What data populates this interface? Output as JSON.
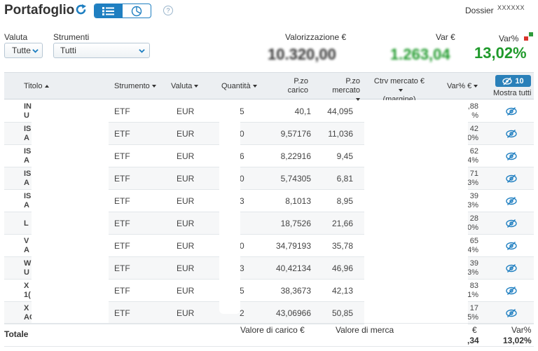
{
  "header": {
    "title": "Portafoglio",
    "dossier_label": "Dossier",
    "dossier_value": "XXXXXX",
    "help_label": "?"
  },
  "filters": {
    "valuta_label": "Valuta",
    "valuta_value": "Tutte",
    "strumenti_label": "Strumenti",
    "strumenti_value": "Tutti"
  },
  "summary": {
    "valorizzazione_label": "Valorizzazione €",
    "valorizzazione_value": "10.320,00",
    "var_eur_label": "Var €",
    "var_eur_value": "1.263,04",
    "var_pct_label": "Var%",
    "var_pct_value": "13,02%"
  },
  "table": {
    "columns": {
      "titolo": "Titolo",
      "strumento": "Strumento",
      "valuta": "Valuta",
      "quantita": "Quantità",
      "pzo_carico_1": "P.zo",
      "pzo_carico_2": "carico",
      "pzo_mercato_1": "P.zo",
      "pzo_mercato_2": "mercato",
      "ctrv_1": "Ctrv mercato €",
      "ctrv_2": "(margine)",
      "varpct": "Var% €"
    },
    "hidden_count": "10",
    "mostra_tutti": "Mostra tutti",
    "rows": [
      {
        "t1": "IN",
        "t2": "U",
        "strumento": "ETF",
        "valuta": "EUR",
        "qty": "5",
        "carico": "40,1",
        "mercato": "44,095",
        "v1": ",88",
        "v2": "%"
      },
      {
        "t1": "IS",
        "t2": "A",
        "strumento": "ETF",
        "valuta": "EUR",
        "qty": "0",
        "carico": "9,57176",
        "mercato": "11,036",
        "v1": "42",
        "v2": "0%"
      },
      {
        "t1": "IS",
        "t2": "A",
        "strumento": "ETF",
        "valuta": "EUR",
        "qty": "6",
        "carico": "8,22916",
        "mercato": "9,45",
        "v1": "62",
        "v2": "4%"
      },
      {
        "t1": "IS",
        "t2": "A",
        "strumento": "ETF",
        "valuta": "EUR",
        "qty": "0",
        "carico": "5,74305",
        "mercato": "6,81",
        "v1": "71",
        "v2": "3%"
      },
      {
        "t1": "IS",
        "t2": "A",
        "strumento": "ETF",
        "valuta": "EUR",
        "qty": "3",
        "carico": "8,1013",
        "mercato": "8,95",
        "v1": "39",
        "v2": "3%"
      },
      {
        "t1": "L",
        "t2": "",
        "strumento": "ETF",
        "valuta": "EUR",
        "qty": "",
        "carico": "18,7526",
        "mercato": "21,66",
        "v1": "28",
        "v2": "0%"
      },
      {
        "t1": "V",
        "t2": "A",
        "strumento": "ETF",
        "valuta": "EUR",
        "qty": "0",
        "carico": "34,79193",
        "mercato": "35,78",
        "v1": "65",
        "v2": "4%"
      },
      {
        "t1": "W",
        "t2": "U",
        "strumento": "ETF",
        "valuta": "EUR",
        "qty": "3",
        "carico": "40,42134",
        "mercato": "46,96",
        "v1": "39",
        "v2": "3%"
      },
      {
        "t1": "X",
        "t2": "1(",
        "strumento": "ETF",
        "valuta": "EUR",
        "qty": "5",
        "carico": "38,3673",
        "mercato": "42,13",
        "v1": "83",
        "v2": "1%"
      },
      {
        "t1": "X",
        "t2": "AC",
        "strumento": "ETF",
        "valuta": "EUR",
        "qty": "2",
        "carico": "43,06966",
        "mercato": "50,85",
        "v1": "17",
        "v2": "5%"
      }
    ]
  },
  "footer": {
    "totale": "Totale",
    "valore_carico_label": "Valore di carico €",
    "valore_mercato_label": "Valore di merca",
    "var_eur_label": "€",
    "var_eur_value": ",34",
    "var_pct_label": "Var%",
    "var_pct_value": "13,02%"
  },
  "colors": {
    "accent": "#1f7fc1",
    "positive": "#1f9a2b",
    "flag_red": "#d9342b",
    "flag_green": "#2e9b3a"
  }
}
